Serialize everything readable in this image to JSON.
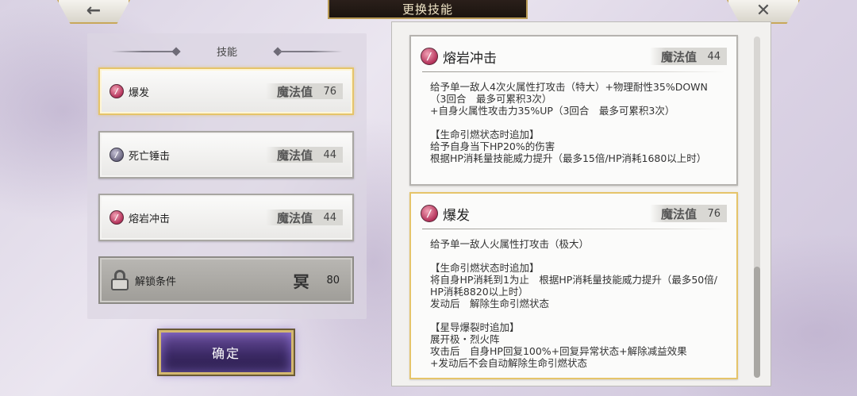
{
  "header": {
    "title": "更换技能",
    "back_glyph": "←",
    "close_glyph": "✕"
  },
  "left_panel": {
    "section_title": "技能",
    "skills": [
      {
        "name": "爆发",
        "mp_label": "魔法值",
        "mp_value": "76",
        "selected": true,
        "icon": "flame-skill-icon"
      },
      {
        "name": "死亡锤击",
        "mp_label": "魔法值",
        "mp_value": "44",
        "selected": false,
        "icon": "hammer-skill-icon"
      },
      {
        "name": "熔岩冲击",
        "mp_label": "魔法值",
        "mp_value": "44",
        "selected": false,
        "icon": "lava-skill-icon"
      }
    ],
    "locked": {
      "label": "解锁条件",
      "star_glyph": "冥",
      "value": "80",
      "icon": "lock-icon"
    },
    "confirm_label": "确定"
  },
  "details": [
    {
      "title": "熔岩冲击",
      "mp_label": "魔法值",
      "mp_value": "44",
      "text": "给予单一敌人4次火属性打攻击（特大）+物理耐性35%DOWN（3回合　最多可累积3次）\n+自身火属性攻击力35%UP（3回合　最多可累积3次）\n\n【生命引燃状态时追加】\n给予自身当下HP20%的伤害\n根据HP消耗量技能威力提升（最多15倍/HP消耗1680以上时）"
    },
    {
      "title": "爆发",
      "mp_label": "魔法值",
      "mp_value": "76",
      "text": "给予单一敌人火属性打攻击（极大）\n\n【生命引燃状态时追加】\n将自身HP消耗到1为止　根据HP消耗量技能威力提升（最多50倍/HP消耗8820以上时）\n发动后　解除生命引燃状态\n\n【星导爆裂时追加】\n展开极・烈火阵\n攻击后　自身HP回复100%+回复异常状态+解除减益效果\n+发动后不会自动解除生命引燃状态"
    }
  ],
  "colors": {
    "accent_gold": "#e5c46a",
    "title_bar": "#1b140f",
    "confirm_purple": "#3c2a66"
  }
}
